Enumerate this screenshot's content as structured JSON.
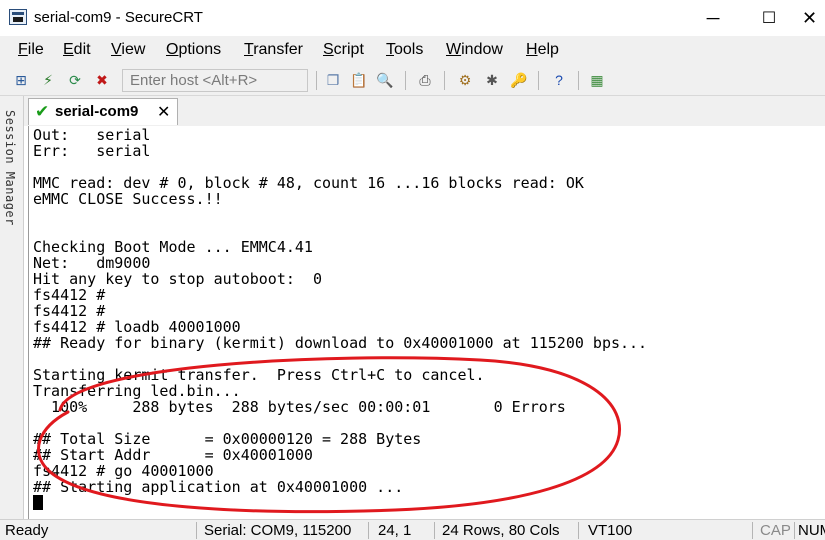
{
  "window": {
    "title": "serial-com9 - SecureCRT",
    "controls": {
      "minimize": "─",
      "maximize": "☐",
      "close": "✕"
    }
  },
  "menu": [
    "File",
    "Edit",
    "View",
    "Options",
    "Transfer",
    "Script",
    "Tools",
    "Window",
    "Help"
  ],
  "toolbar": {
    "host_placeholder": "Enter host <Alt+R>",
    "icons": [
      "connect-icon",
      "quick-connect-icon",
      "reconnect-icon",
      "disconnect-icon",
      "copy-icon",
      "paste-icon",
      "find-icon",
      "print-icon",
      "session-options-icon",
      "global-options-icon",
      "keymap-icon",
      "help-icon",
      "about-icon"
    ]
  },
  "sidebar": {
    "label": "Session Manager"
  },
  "tab": {
    "label": "serial-com9",
    "close": "✕"
  },
  "terminal": {
    "lines": [
      "Out:   serial",
      "Err:   serial",
      "",
      "MMC read: dev # 0, block # 48, count 16 ...16 blocks read: OK",
      "eMMC CLOSE Success.!!",
      "",
      "",
      "Checking Boot Mode ... EMMC4.41",
      "Net:   dm9000",
      "Hit any key to stop autoboot:  0",
      "fs4412 #",
      "fs4412 #",
      "fs4412 # loadb 40001000",
      "## Ready for binary (kermit) download to 0x40001000 at 115200 bps...",
      "",
      "Starting kermit transfer.  Press Ctrl+C to cancel.",
      "Transferring led.bin...",
      "  100%     288 bytes  288 bytes/sec 00:00:01       0 Errors",
      "",
      "## Total Size      = 0x00000120 = 288 Bytes",
      "## Start Addr      = 0x40001000",
      "fs4412 # go 40001000",
      "## Starting application at 0x40001000 ..."
    ],
    "annotation_color": "#e0191e"
  },
  "status": {
    "ready": "Ready",
    "connection": "Serial: COM9, 115200",
    "position": "24,  1",
    "size": "24 Rows, 80 Cols",
    "emulation": "VT100",
    "caps": "CAP",
    "num": "NUM"
  }
}
